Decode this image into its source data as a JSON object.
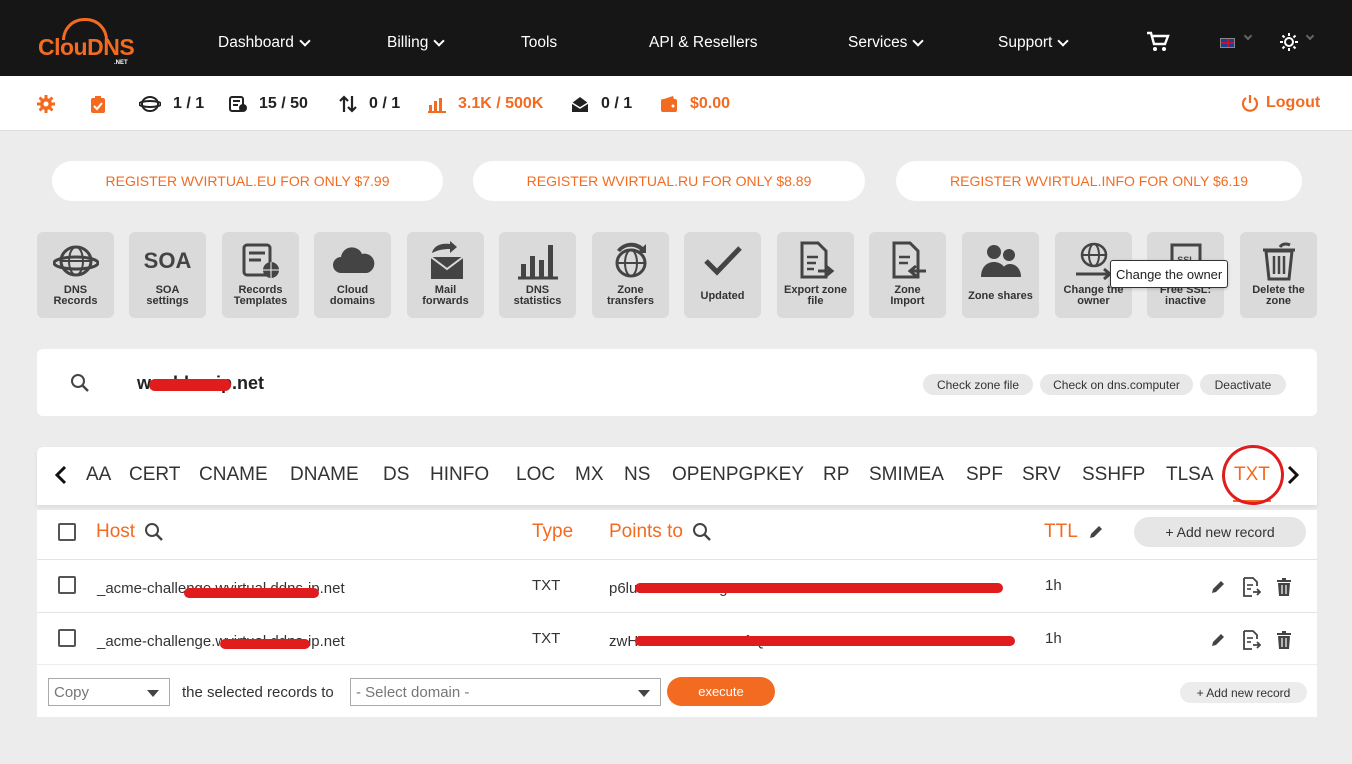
{
  "brand": {
    "name": "ClouDNS",
    "suffix": ".NET",
    "accent": "#f26b21",
    "dark": "#161616"
  },
  "nav": {
    "dashboard": "Dashboard",
    "billing": "Billing",
    "tools": "Tools",
    "api": "API & Resellers",
    "services": "Services",
    "support": "Support"
  },
  "stats": {
    "zones": "1 / 1",
    "records": "15 / 50",
    "transfers": "0 / 1",
    "queries": "3.1K / 500K",
    "mail": "0 / 1",
    "balance": "$0.00",
    "logout": "Logout"
  },
  "promos": [
    "REGISTER WVIRTUAL.EU FOR ONLY $7.99",
    "REGISTER WVIRTUAL.RU FOR ONLY $8.89",
    "REGISTER WVIRTUAL.INFO FOR ONLY $6.19"
  ],
  "tools": [
    {
      "label1": "DNS",
      "label2": "Records",
      "icon": "globe-icon"
    },
    {
      "label1": "SOA",
      "label2": "settings",
      "icon": "soa-icon",
      "icon_text": "SOA"
    },
    {
      "label1": "Records",
      "label2": "Templates",
      "icon": "template-icon"
    },
    {
      "label1": "Cloud",
      "label2": "domains",
      "icon": "cloud-icon"
    },
    {
      "label1": "Mail",
      "label2": "forwards",
      "icon": "mail-forward-icon"
    },
    {
      "label1": "DNS",
      "label2": "statistics",
      "icon": "bar-chart-icon"
    },
    {
      "label1": "Zone",
      "label2": "transfers",
      "icon": "zone-transfer-icon"
    },
    {
      "label1": "Updated",
      "label2": "",
      "icon": "checkmark-icon"
    },
    {
      "label1": "Export zone",
      "label2": "file",
      "icon": "export-file-icon"
    },
    {
      "label1": "Zone",
      "label2": "Import",
      "icon": "import-file-icon"
    },
    {
      "label1": "Zone shares",
      "label2": "",
      "icon": "users-icon"
    },
    {
      "label1": "Change the",
      "label2": "owner",
      "icon": "change-owner-icon"
    },
    {
      "label1": "Free SSL:",
      "label2": "inactive",
      "icon": "ssl-icon"
    },
    {
      "label1": "Delete the",
      "label2": "zone",
      "icon": "trash-icon"
    }
  ],
  "tooltip": "Change the owner",
  "zone": {
    "name_prefix": "w",
    "name_suffix": "ddns-ip.net",
    "buttons": [
      "Check zone file",
      "Check on dns.computer",
      "Deactivate"
    ]
  },
  "record_types": [
    "AA",
    "CERT",
    "CNAME",
    "DNAME",
    "DS",
    "HINFO",
    "LOC",
    "MX",
    "NS",
    "OPENPGPKEY",
    "RP",
    "SMIMEA",
    "SPF",
    "SRV",
    "SSHFP",
    "TLSA",
    "TXT"
  ],
  "active_type": "TXT",
  "table": {
    "headers": {
      "host": "Host",
      "type": "Type",
      "points_to": "Points to",
      "ttl": "TTL"
    },
    "add_button": "+ Add new record",
    "rows": [
      {
        "host": "_acme-challenge.wvirtual.ddns-ip.net",
        "type": "TXT",
        "points_to": "p6lu...1NGsTrVJg",
        "ttl": "1h"
      },
      {
        "host": "_acme-challenge.wvirtual.ddns-ip.net",
        "type": "TXT",
        "points_to": "zwHVJMK2020...CXftQ",
        "ttl": "1h"
      }
    ]
  },
  "footer": {
    "action_value": "Copy",
    "label": "the selected records to",
    "domain_placeholder": "- Select domain -",
    "execute": "execute",
    "add_button": "+ Add new record"
  }
}
